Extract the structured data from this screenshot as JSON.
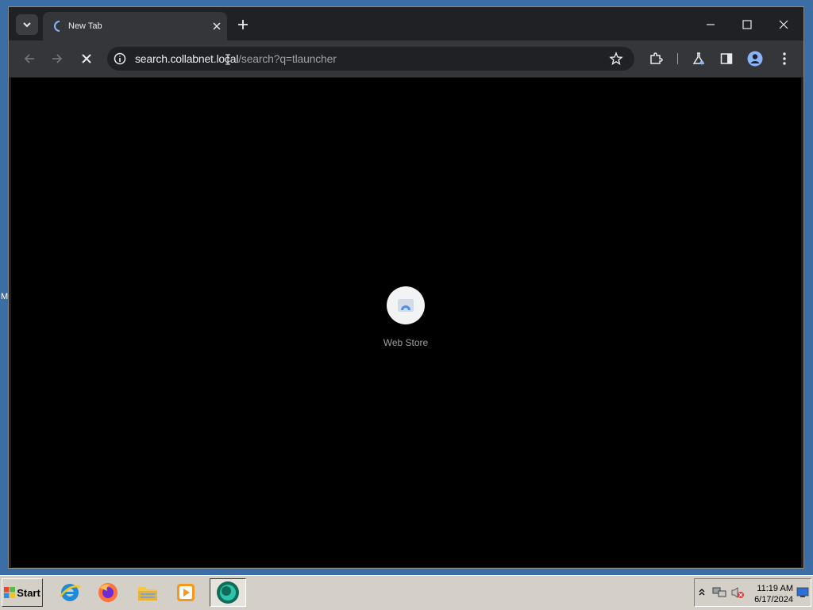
{
  "desktop": {
    "edge_label": "M"
  },
  "browser": {
    "tab": {
      "title": "New Tab"
    },
    "address_bar": {
      "url_host": "search.collabnet.local",
      "url_path": "/search?q=tlauncher"
    },
    "new_tab_page": {
      "shortcuts": [
        {
          "label": "Web Store",
          "icon": "web-store-icon"
        }
      ]
    },
    "accent_color": "#8ab4f8"
  },
  "taskbar": {
    "start_label": "Start",
    "apps": [
      {
        "name": "internet-explorer-icon"
      },
      {
        "name": "firefox-icon"
      },
      {
        "name": "file-explorer-icon"
      },
      {
        "name": "media-player-icon"
      },
      {
        "name": "chrome-app-icon",
        "active": true
      }
    ],
    "clock": {
      "time": "11:19 AM",
      "date": "6/17/2024"
    }
  }
}
